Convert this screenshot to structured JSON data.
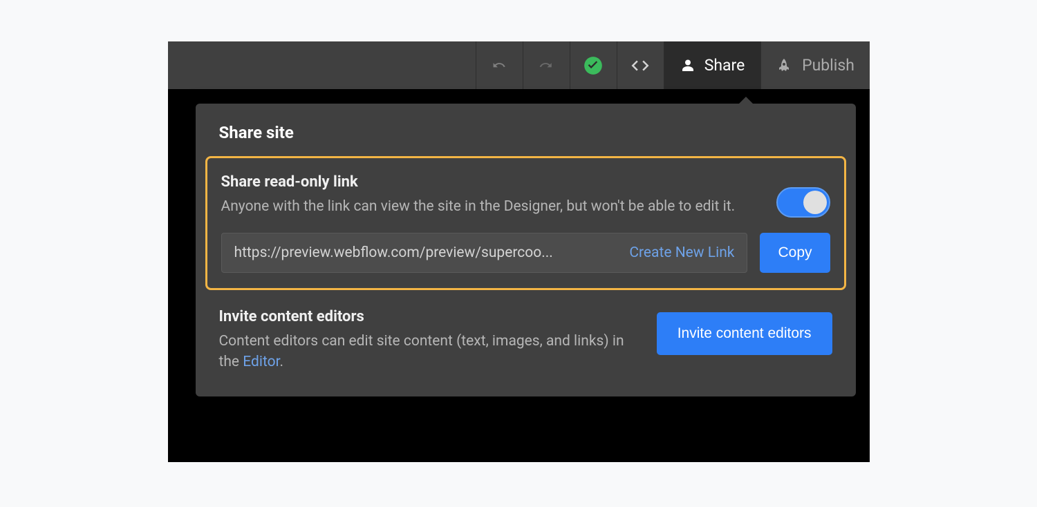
{
  "toolbar": {
    "share_label": "Share",
    "publish_label": "Publish"
  },
  "panel": {
    "title": "Share site",
    "share_link": {
      "title": "Share read-only link",
      "description": "Anyone with the link can view the site in the Designer, but won't be able to edit it.",
      "toggle_on": true,
      "url": "https://preview.webflow.com/preview/supercoo...",
      "create_new_label": "Create New Link",
      "copy_label": "Copy"
    },
    "invite": {
      "title": "Invite content editors",
      "description_pre": "Content editors can edit site content (text, images, and links) in the ",
      "editor_link_label": "Editor",
      "description_post": ".",
      "button_label": "Invite content editors"
    }
  }
}
